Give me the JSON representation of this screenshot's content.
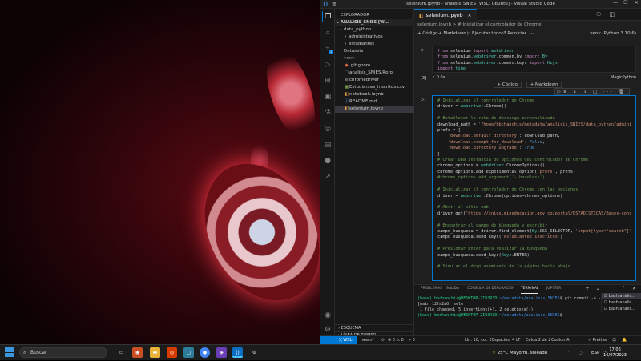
{
  "window": {
    "title": "selenium.ipynb - analisis_SNIES [WSL: Ubuntu] - Visual Studio Code",
    "menu_icon": "hamburger-icon",
    "logo_icon": "vscode-logo-icon"
  },
  "activity_bar": {
    "items": [
      "explorer-icon",
      "search-icon",
      "source-control-icon",
      "run-debug-icon",
      "extensions-icon",
      "remote-explorer-icon",
      "testing-icon",
      "jupyter-icon",
      "docker-icon",
      "github-icon",
      "live-share-icon"
    ],
    "source_control_badge": "1",
    "bottom": [
      "accounts-icon",
      "settings-gear-icon"
    ]
  },
  "explorer": {
    "header": "EXPLORADOR",
    "root": "ANALISIS_SNIES [W...",
    "items": [
      {
        "label": "data_python",
        "type": "folder-open",
        "depth": 1
      },
      {
        "label": "administrativos",
        "type": "folder",
        "depth": 2
      },
      {
        "label": "estudiantes",
        "type": "folder",
        "depth": 2
      },
      {
        "label": "Datasets",
        "type": "folder",
        "depth": 1
      },
      {
        "label": "venv",
        "type": "folder",
        "depth": 1
      },
      {
        "label": ".gitignore",
        "type": "git",
        "depth": 1
      },
      {
        "label": "analisis_SNIES.Rproj",
        "type": "txt",
        "depth": 1
      },
      {
        "label": "chromedriver",
        "type": "txt",
        "depth": 1
      },
      {
        "label": "Estudiantes_inscritos.csv",
        "type": "csv",
        "depth": 1
      },
      {
        "label": "notebook.ipynb",
        "type": "nb",
        "depth": 1
      },
      {
        "label": "README.md",
        "type": "md",
        "depth": 1
      },
      {
        "label": "selenium.ipynb",
        "type": "nb",
        "depth": 1
      }
    ],
    "outline": "ESQUEMA",
    "timeline": "LÍNEA DE TIEMPO"
  },
  "editor": {
    "tab_label": "selenium.ipynb",
    "breadcrumb": "selenium.ipynb > # Inicializar el controlador de Chrome",
    "toolbar": {
      "code": "+ Código",
      "markdown": "+ Markdown",
      "run_all": "▷ Ejecutar todo",
      "restart": "↺ Reiniciar",
      "kernel": "venv (Python 3.10.6)"
    },
    "cell1": {
      "lines": [
        "from selenium import webdriver",
        "from selenium.webdriver.common.by import By",
        "from selenium.webdriver.common.keys import Keys",
        "import time"
      ],
      "exec_count": "[3]",
      "exec_time": "0.0s",
      "lang": "MagicPython"
    },
    "add_code": "+ Código",
    "add_markdown": "+ Markdown",
    "cell2": {
      "lines": [
        "# Inicializar el controlador de Chrome",
        "driver = webdriver.Chrome()",
        "",
        "# Establecer la ruta de descarga personalizada",
        "download_path = '/home/bbchanchis/metadata/analisis_SNIES/data_python/admini",
        "prefs = {",
        "    'download.default_directory': download_path,",
        "    'download.prompt_for_download': False,",
        "    'download.directory_upgrade': True",
        "}",
        "# Crear una instancia de opciones del controlador de Chrome",
        "chrome_options = webdriver.ChromeOptions()",
        "chrome_options.add_experimental_option('prefs', prefs)",
        "#chrome_options.add_argument('--headless')",
        "",
        "# Inicializar el controlador de Chrome con las opciones",
        "driver = webdriver.Chrome(options=chrome_options)",
        "",
        "# Abrir el sitio web",
        "driver.get('https://snies.mineducacion.gov.co/portal/ESTADISTICAS/Bases-cons",
        "",
        "# Encontrar el campo de búsqueda y escribir",
        "campo_busqueda = driver.find_element(By.CSS_SELECTOR, 'input[type=\"search\"]'",
        "campo_busqueda.send_keys('estudiantes inscritos')",
        "",
        "# Presionar Enter para realizar la búsqueda",
        "campo_busqueda.send_keys(Keys.ENTER)",
        "",
        "# Simular el desplazamiento de la página hacia abajo"
      ]
    }
  },
  "panel": {
    "tabs": [
      "PROBLEMAS",
      "SALIDA",
      "CONSOLA DE DEPURACIÓN",
      "TERMINAL",
      "JUPYTER"
    ],
    "active_tab": "TERMINAL",
    "terminal_lines": [
      {
        "prompt": "(base) bbchanchis@DESKTOP-2I93R3D:",
        "path": "~/metadata/analisis_SNIES",
        "cmd": "$ git commit -a -m \"sele\""
      },
      {
        "text": "[main 12fa2a0] sele"
      },
      {
        "text": " 1 file changed, 5 insertions(+), 2 deletions(-)"
      },
      {
        "prompt": "(base) bbchanchis@DESKTOP-2I93R3D:",
        "path": "~/metadata/analisis_SNIES",
        "cmd": "$ "
      }
    ],
    "terminals": [
      "bash analis...",
      "bash analis...",
      "bash analis..."
    ]
  },
  "statusbar": {
    "remote": "WSL: Ubuntu",
    "branch": "main*",
    "sync": "⟳",
    "errors": "⊗ 0 ⚠ 0",
    "ports": "⑂ 0",
    "position": "Lín. 10, col. 2",
    "spaces": "Espacios: 4",
    "eol": "LF",
    "cell": "Celda 2 de 2",
    "codium": "CodiumAI",
    "prettier": "✓ Prettier"
  },
  "taskbar": {
    "search_placeholder": "Buscar",
    "weather": "25°C  Mayorm. soleado",
    "lang": "ESP",
    "time": "17:06",
    "date": "16/07/2023"
  }
}
